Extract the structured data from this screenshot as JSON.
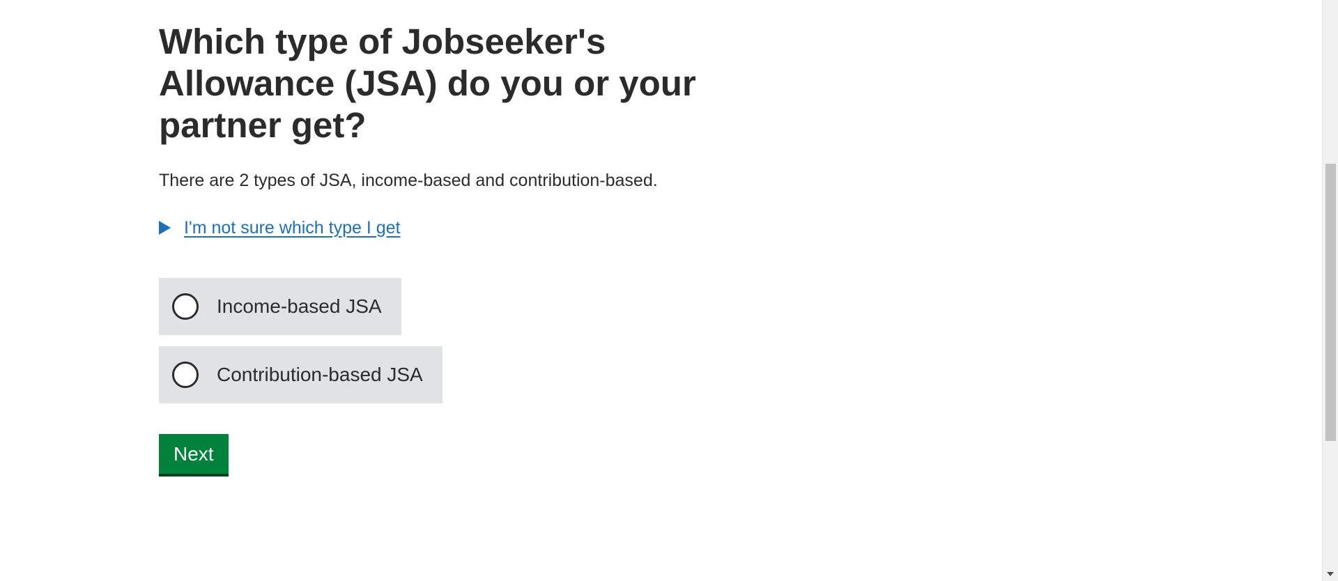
{
  "question": {
    "heading": "Which type of Jobseeker's Allowance (JSA) do you or your partner get?",
    "hint": "There are 2 types of JSA, income-based and contribution-based.",
    "details_link": "I'm not sure which type I get"
  },
  "options": [
    {
      "label": "Income-based JSA",
      "selected": false
    },
    {
      "label": "Contribution-based JSA",
      "selected": false
    }
  ],
  "actions": {
    "next_label": "Next"
  },
  "colors": {
    "link": "#1d70b8",
    "button": "#00823b",
    "radio_background": "#e0e2e4",
    "text": "#2b2b2b"
  }
}
